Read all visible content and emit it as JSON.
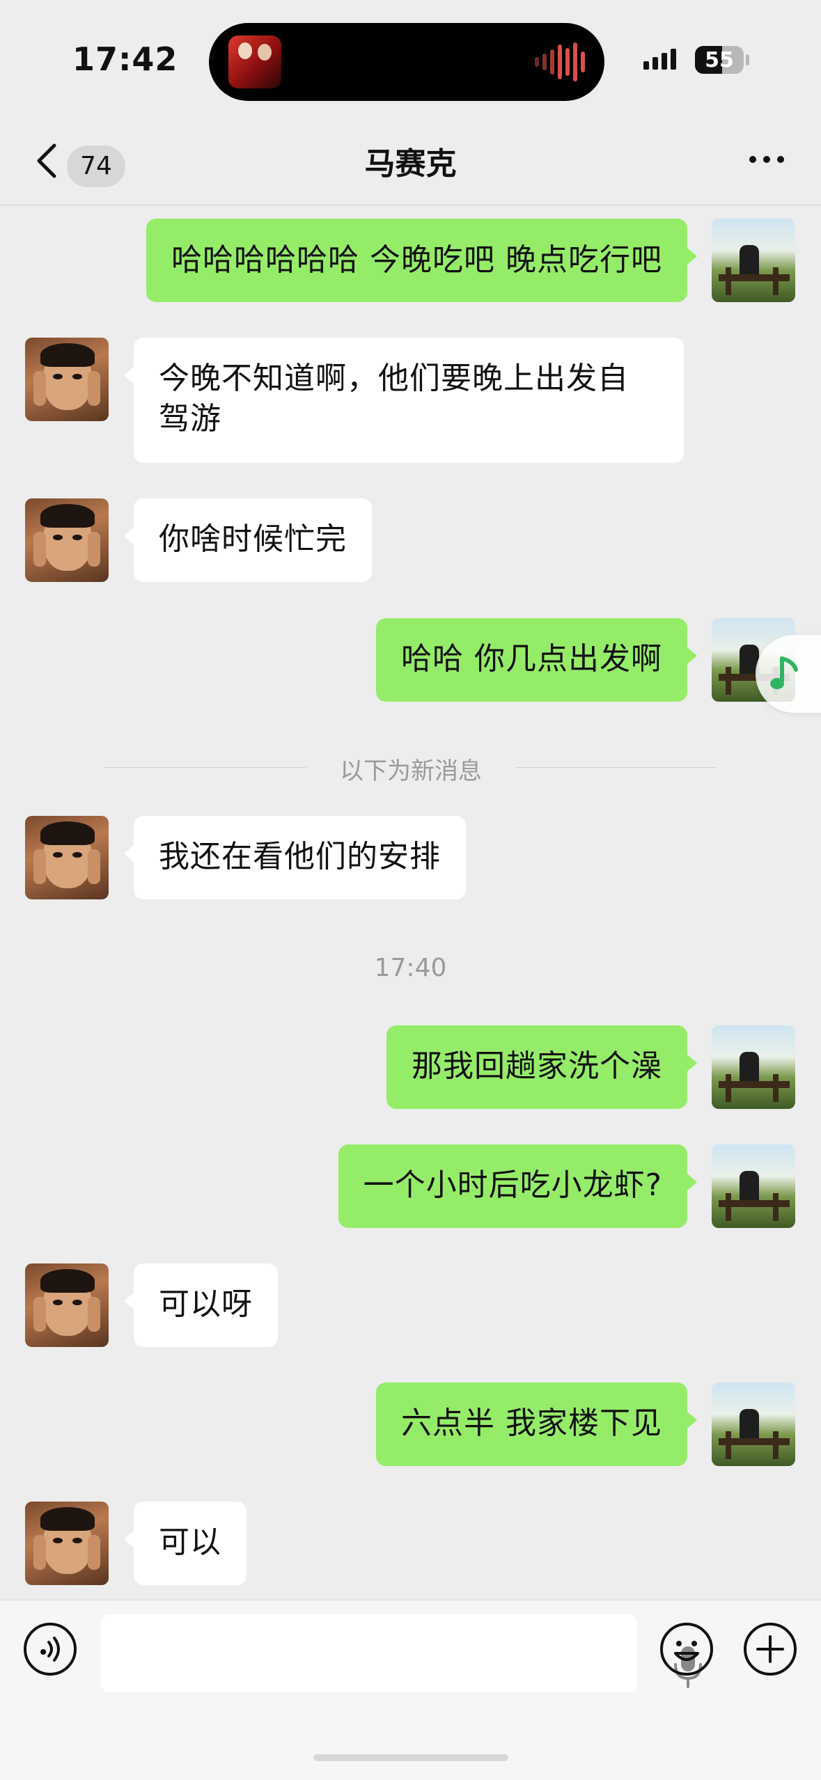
{
  "status_bar": {
    "time": "17:42",
    "battery": "55",
    "battery_level_percent": 55
  },
  "nav": {
    "unread_count": "74",
    "title": "马赛克"
  },
  "messages": [
    {
      "side": "self",
      "text": "哈哈哈哈哈哈 今晚吃吧 晚点吃行吧"
    },
    {
      "side": "other",
      "text": "今晚不知道啊，他们要晚上出发自驾游"
    },
    {
      "side": "other",
      "text": "你啥时候忙完"
    },
    {
      "side": "self",
      "text": "哈哈 你几点出发啊"
    },
    {
      "side": "other",
      "text": "我还在看他们的安排"
    },
    {
      "side": "self",
      "text": "那我回趟家洗个澡"
    },
    {
      "side": "self",
      "text": "一个小时后吃小龙虾?"
    },
    {
      "side": "other",
      "text": "可以呀"
    },
    {
      "side": "self",
      "text": "六点半 我家楼下见"
    },
    {
      "side": "other",
      "text": "可以"
    }
  ],
  "new_messages_divider": "以下为新消息",
  "timestamp": "17:40",
  "colors": {
    "self_bubble": "#95EC69",
    "other_bubble": "#FFFFFF",
    "background": "#EDEDED"
  }
}
